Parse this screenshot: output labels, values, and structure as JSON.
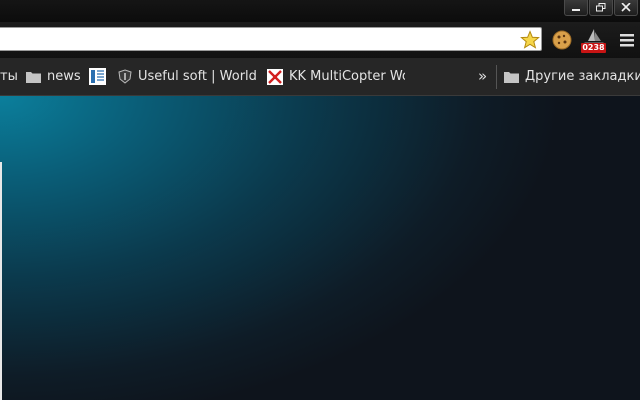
{
  "window": {
    "minimize_label": "minimize",
    "maximize_label": "restore",
    "close_label": "close"
  },
  "toolbar": {
    "omnibox_value": "",
    "extension_badge": "0238"
  },
  "bookmarks": {
    "items": [
      {
        "label": "ты",
        "icon": "folder-icon"
      },
      {
        "label": "news",
        "icon": "folder-icon"
      },
      {
        "label": "",
        "icon": "site-favicon"
      },
      {
        "label": "Useful soft | World o",
        "icon": "shield-favicon"
      },
      {
        "label": "KK MultiCopter Wor",
        "icon": "x-favicon"
      }
    ],
    "overflow": "»",
    "other_label": "Другие закладки"
  },
  "colors": {
    "accent": "#0b7f9c",
    "badge": "#c81414"
  }
}
